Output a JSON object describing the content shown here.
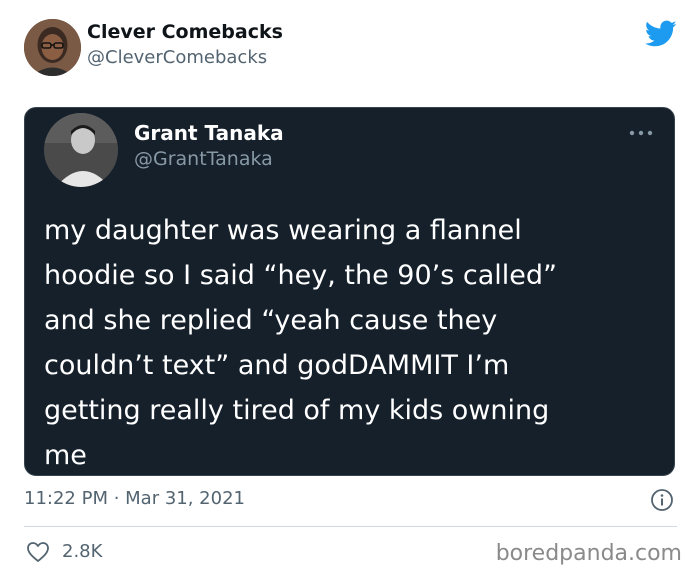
{
  "outer_tweet": {
    "display_name": "Clever Comebacks",
    "handle": "@CleverComebacks",
    "avatar_icon": "person-avatar",
    "brand_icon": "twitter-bird-icon",
    "brand_color": "#1d9bf0"
  },
  "quoted_tweet": {
    "display_name": "Grant Tanaka",
    "handle": "@GrantTanaka",
    "avatar_icon": "person-avatar",
    "more_icon": "more-dots-icon",
    "text_lines": [
      "my daughter was wearing a flannel",
      "hoodie so I said “hey, the 90’s called”",
      "and she replied “yeah cause they",
      "couldn’t text” and godDAMMIT I’m",
      "getting really tired of my kids owning",
      "me"
    ],
    "background_color": "#15202b"
  },
  "footer": {
    "timestamp": "11:22 PM · Mar 31, 2021",
    "info_icon": "info-icon",
    "like_icon": "heart-icon",
    "like_count": "2.8K"
  },
  "watermark": "boredpanda.com"
}
